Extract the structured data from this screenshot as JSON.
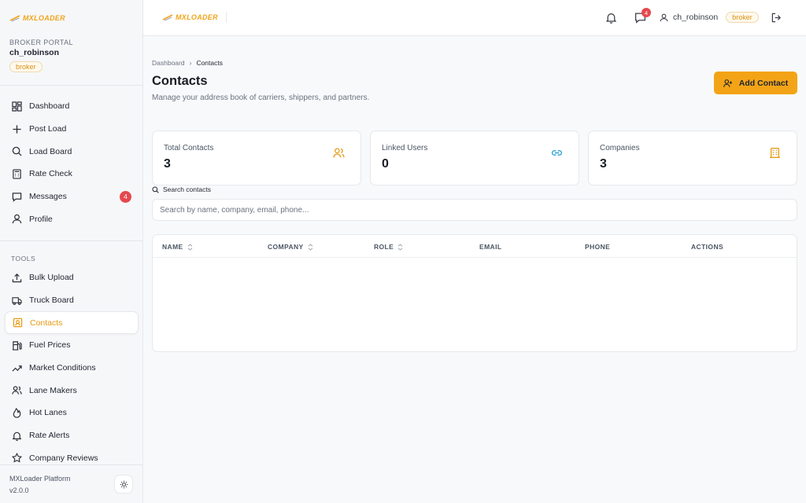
{
  "brand": {
    "logo_text": "MXLOADER",
    "accent": "#f3a416"
  },
  "sidebar": {
    "portal_label": "BROKER PORTAL",
    "username": "ch_robinson",
    "role": "broker",
    "main_items": [
      {
        "label": "Dashboard",
        "icon": "dashboard-icon"
      },
      {
        "label": "Post Load",
        "icon": "plus-icon"
      },
      {
        "label": "Load Board",
        "icon": "search-icon"
      },
      {
        "label": "Rate Check",
        "icon": "calculator-icon"
      },
      {
        "label": "Messages",
        "icon": "message-icon",
        "badge": "4"
      },
      {
        "label": "Profile",
        "icon": "user-icon"
      }
    ],
    "tools_label": "TOOLS",
    "tool_items": [
      {
        "label": "Bulk Upload",
        "icon": "upload-icon"
      },
      {
        "label": "Truck Board",
        "icon": "truck-icon"
      },
      {
        "label": "Contacts",
        "icon": "contact-icon",
        "active": true
      },
      {
        "label": "Fuel Prices",
        "icon": "fuel-icon"
      },
      {
        "label": "Market Conditions",
        "icon": "trending-up-icon"
      },
      {
        "label": "Lane Makers",
        "icon": "users-icon"
      },
      {
        "label": "Hot Lanes",
        "icon": "flame-icon"
      },
      {
        "label": "Rate Alerts",
        "icon": "bell-icon"
      },
      {
        "label": "Company Reviews",
        "icon": "star-icon"
      }
    ],
    "footer": {
      "platform": "MXLoader Platform",
      "version": "v2.0.0"
    }
  },
  "header": {
    "messages_badge": "4",
    "username": "ch_robinson",
    "role": "broker"
  },
  "main": {
    "breadcrumb": [
      "Dashboard",
      "Contacts"
    ],
    "title": "Contacts",
    "subtitle": "Manage your address book of carriers, shippers, and partners.",
    "add_button": "Add Contact",
    "stats": [
      {
        "label": "Total Contacts",
        "value": "3",
        "icon": "users-icon",
        "color": "#e59a13"
      },
      {
        "label": "Linked Users",
        "value": "0",
        "icon": "link-icon",
        "color": "#2a9fd6"
      },
      {
        "label": "Companies",
        "value": "3",
        "icon": "building-icon",
        "color": "#e59a13"
      }
    ],
    "search": {
      "label": "Search contacts",
      "placeholder": "Search by name, company, email, phone..."
    },
    "table": {
      "columns": [
        {
          "label": "NAME",
          "sortable": true
        },
        {
          "label": "COMPANY",
          "sortable": true
        },
        {
          "label": "ROLE",
          "sortable": true
        },
        {
          "label": "EMAIL",
          "sortable": false
        },
        {
          "label": "PHONE",
          "sortable": false
        },
        {
          "label": "ACTIONS",
          "sortable": false
        }
      ],
      "rows": []
    }
  }
}
